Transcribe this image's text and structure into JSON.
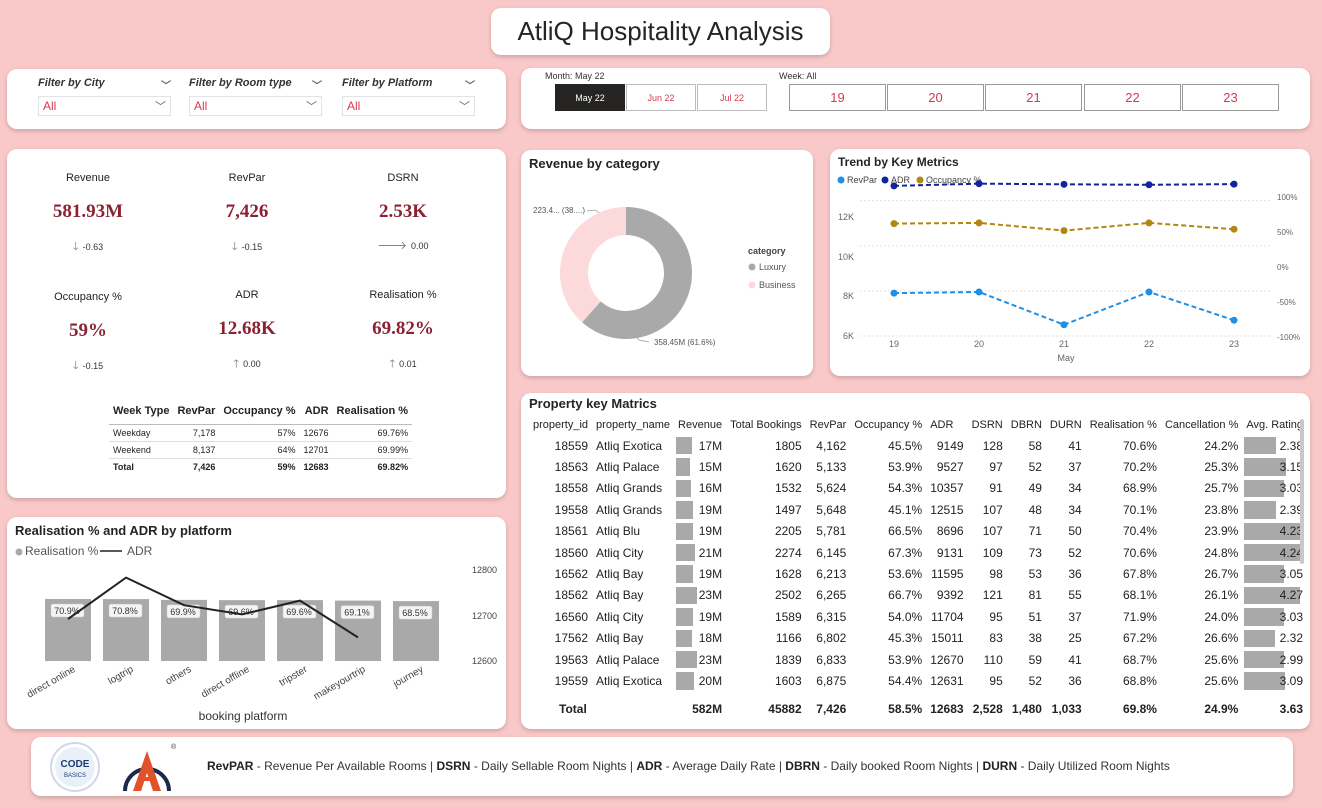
{
  "title": "AtliQ Hospitality Analysis",
  "filters": [
    {
      "label": "Filter by City",
      "value": "All"
    },
    {
      "label": "Filter by Room type",
      "value": "All"
    },
    {
      "label": "Filter by Platform",
      "value": "All"
    }
  ],
  "month_slicer": {
    "label": "Month: May 22",
    "options": [
      "May 22",
      "Jun 22",
      "Jul 22"
    ],
    "selected": "May 22"
  },
  "week_slicer": {
    "label": "Week: All",
    "options": [
      "19",
      "20",
      "21",
      "22",
      "23"
    ]
  },
  "kpis": [
    {
      "name": "Revenue",
      "value": "581.93M",
      "change": "-0.63",
      "dir": "down"
    },
    {
      "name": "RevPar",
      "value": "7,426",
      "change": "-0.15",
      "dir": "down"
    },
    {
      "name": "DSRN",
      "value": "2.53K",
      "change": "0.00",
      "dir": "right"
    },
    {
      "name": "Occupancy %",
      "value": "59%",
      "change": "-0.15",
      "dir": "down"
    },
    {
      "name": "ADR",
      "value": "12.68K",
      "change": "0.00",
      "dir": "up"
    },
    {
      "name": "Realisation %",
      "value": "69.82%",
      "change": "0.01",
      "dir": "up"
    }
  ],
  "week_type_table": {
    "headers": [
      "Week Type",
      "RevPar",
      "Occupancy %",
      "ADR",
      "Realisation %"
    ],
    "rows": [
      [
        "Weekday",
        "7,178",
        "57%",
        "12676",
        "69.76%"
      ],
      [
        "Weekend",
        "8,137",
        "64%",
        "12701",
        "69.99%"
      ]
    ],
    "total": [
      "Total",
      "7,426",
      "59%",
      "12683",
      "69.82%"
    ]
  },
  "revenue_by_category": {
    "title": "Revenue by category",
    "legend_title": "category",
    "slices": [
      {
        "name": "Luxury",
        "label": "358.45M (61.6%)",
        "percent": 61.6,
        "color": "#a9a9a9"
      },
      {
        "name": "Business",
        "label": "223.4... (38....)",
        "percent": 38.4,
        "color": "#fcd9db"
      }
    ]
  },
  "trend": {
    "title": "Trend by Key Metrics",
    "legend": [
      {
        "name": "RevPar",
        "color": "#1f8fe5"
      },
      {
        "name": "ADR",
        "color": "#12239e"
      },
      {
        "name": "Occupancy %",
        "color": "#b0870f"
      }
    ],
    "left_ticks": [
      "12K",
      "10K",
      "8K",
      "6K"
    ],
    "right_ticks": [
      "100%",
      "50%",
      "0%",
      "-50%",
      "-100%"
    ],
    "x_label": "May"
  },
  "platform_chart": {
    "title": "Realisation % and ADR by platform",
    "legend": [
      "Realisation %",
      "ADR"
    ],
    "x_title": "booking platform",
    "right_ticks": [
      "12800",
      "12700",
      "12600"
    ]
  },
  "property_table": {
    "title": "Property key Matrics",
    "headers": [
      "property_id",
      "property_name",
      "Revenue",
      "Total Bookings",
      "RevPar",
      "Occupancy %",
      "ADR",
      "DSRN",
      "DBRN",
      "DURN",
      "Realisation %",
      "Cancellation %",
      "Avg. Rating"
    ],
    "rows": [
      [
        "18559",
        "Atliq Exotica",
        "17M",
        "1805",
        "4,162",
        "45.5%",
        "9149",
        "128",
        "58",
        "41",
        "70.6%",
        "24.2%",
        "2.38"
      ],
      [
        "18563",
        "Atliq Palace",
        "15M",
        "1620",
        "5,133",
        "53.9%",
        "9527",
        "97",
        "52",
        "37",
        "70.2%",
        "25.3%",
        "3.15"
      ],
      [
        "18558",
        "Atliq Grands",
        "16M",
        "1532",
        "5,624",
        "54.3%",
        "10357",
        "91",
        "49",
        "34",
        "68.9%",
        "25.7%",
        "3.03"
      ],
      [
        "19558",
        "Atliq Grands",
        "19M",
        "1497",
        "5,648",
        "45.1%",
        "12515",
        "107",
        "48",
        "34",
        "70.1%",
        "23.8%",
        "2.39"
      ],
      [
        "18561",
        "Atliq Blu",
        "19M",
        "2205",
        "5,781",
        "66.5%",
        "8696",
        "107",
        "71",
        "50",
        "70.4%",
        "23.9%",
        "4.23"
      ],
      [
        "18560",
        "Atliq City",
        "21M",
        "2274",
        "6,145",
        "67.3%",
        "9131",
        "109",
        "73",
        "52",
        "70.6%",
        "24.8%",
        "4.24"
      ],
      [
        "16562",
        "Atliq Bay",
        "19M",
        "1628",
        "6,213",
        "53.6%",
        "11595",
        "98",
        "53",
        "36",
        "67.8%",
        "26.7%",
        "3.05"
      ],
      [
        "18562",
        "Atliq Bay",
        "23M",
        "2502",
        "6,265",
        "66.7%",
        "9392",
        "121",
        "81",
        "55",
        "68.1%",
        "26.1%",
        "4.27"
      ],
      [
        "16560",
        "Atliq City",
        "19M",
        "1589",
        "6,315",
        "54.0%",
        "11704",
        "95",
        "51",
        "37",
        "71.9%",
        "24.0%",
        "3.03"
      ],
      [
        "17562",
        "Atliq Bay",
        "18M",
        "1166",
        "6,802",
        "45.3%",
        "15011",
        "83",
        "38",
        "25",
        "67.2%",
        "26.6%",
        "2.32"
      ],
      [
        "19563",
        "Atliq Palace",
        "23M",
        "1839",
        "6,833",
        "53.9%",
        "12670",
        "110",
        "59",
        "41",
        "68.7%",
        "25.6%",
        "2.99"
      ],
      [
        "19559",
        "Atliq Exotica",
        "20M",
        "1603",
        "6,875",
        "54.4%",
        "12631",
        "95",
        "52",
        "36",
        "68.8%",
        "25.6%",
        "3.09"
      ]
    ],
    "total": [
      "Total",
      "",
      "582M",
      "45882",
      "7,426",
      "58.5%",
      "12683",
      "2,528",
      "1,480",
      "1,033",
      "69.8%",
      "24.9%",
      "3.63"
    ]
  },
  "footer": {
    "logo1_text": "CODE BASICS",
    "items": [
      {
        "abbr": "RevPAR",
        "desc": " - Revenue Per Available Rooms | "
      },
      {
        "abbr": "DSRN",
        "desc": " - Daily Sellable Room Nights | "
      },
      {
        "abbr": "ADR",
        "desc": " - Average Daily Rate | "
      },
      {
        "abbr": "DBRN",
        "desc": " - Daily booked Room Nights | "
      },
      {
        "abbr": "DURN",
        "desc": " - Daily Utilized Room Nights"
      }
    ]
  },
  "chart_data": [
    {
      "type": "pie",
      "title": "Revenue by category",
      "categories": [
        "Luxury",
        "Business"
      ],
      "values": [
        358.45,
        223.48
      ],
      "percent": [
        61.6,
        38.4
      ],
      "legend": "right"
    },
    {
      "type": "line",
      "title": "Trend by Key Metrics",
      "x": [
        19,
        20,
        21,
        22,
        23
      ],
      "xlabel": "May",
      "series": [
        {
          "name": "RevPar",
          "axis": "left",
          "values": [
            7900,
            7950,
            6500,
            7950,
            6700
          ]
        },
        {
          "name": "ADR",
          "axis": "left",
          "values": [
            12650,
            12750,
            12720,
            12700,
            12730
          ]
        },
        {
          "name": "Occupancy %",
          "axis": "right",
          "values": [
            62,
            63,
            52,
            63,
            54
          ]
        }
      ],
      "ylim_left": [
        6000,
        13000
      ],
      "ylim_right": [
        -100,
        100
      ],
      "legend": "top-left"
    },
    {
      "type": "bar",
      "title": "Realisation % and ADR by platform",
      "categories": [
        "direct online",
        "logtrip",
        "others",
        "direct offline",
        "tripster",
        "makeyourtrip",
        "journey"
      ],
      "series": [
        {
          "name": "Realisation %",
          "type": "bar",
          "values": [
            70.9,
            70.8,
            69.9,
            69.6,
            69.6,
            69.1,
            68.5
          ],
          "labels": [
            "70.9%",
            "70.8%",
            "69.9%",
            "69.6%",
            "69.6%",
            "69.1%",
            "68.5%"
          ]
        },
        {
          "name": "ADR",
          "type": "line",
          "axis": "right",
          "values": [
            12700,
            12790,
            12730,
            12710,
            12740,
            12660,
            null
          ]
        }
      ],
      "xlabel": "booking platform",
      "ylim_right": [
        12600,
        12800
      ]
    }
  ]
}
